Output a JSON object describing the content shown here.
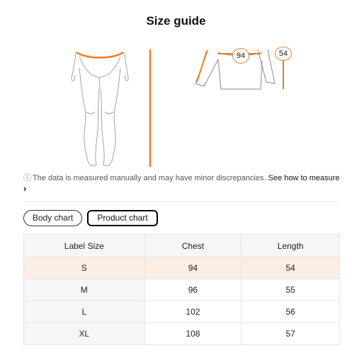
{
  "title": "Size guide",
  "diagram": {
    "chest_badge": "94",
    "length_badge": "54",
    "accent_color": "#f07c1e"
  },
  "note": {
    "icon": "info-icon",
    "text": "The data is measured manually and may have minor discrepancies.",
    "link": "See how to measure",
    "chevron": "›"
  },
  "tabs": [
    {
      "label": "Body chart",
      "active": false
    },
    {
      "label": "Product chart",
      "active": true
    }
  ],
  "table": {
    "headers": [
      "Label Size",
      "Chest",
      "Length"
    ],
    "rows": [
      {
        "size": "S",
        "chest": "94",
        "length": "54",
        "selected": true
      },
      {
        "size": "M",
        "chest": "96",
        "length": "55",
        "selected": false
      },
      {
        "size": "L",
        "chest": "102",
        "length": "56",
        "selected": false
      },
      {
        "size": "XL",
        "chest": "108",
        "length": "57",
        "selected": false
      }
    ],
    "selected_row_color": "#fdeee3"
  }
}
